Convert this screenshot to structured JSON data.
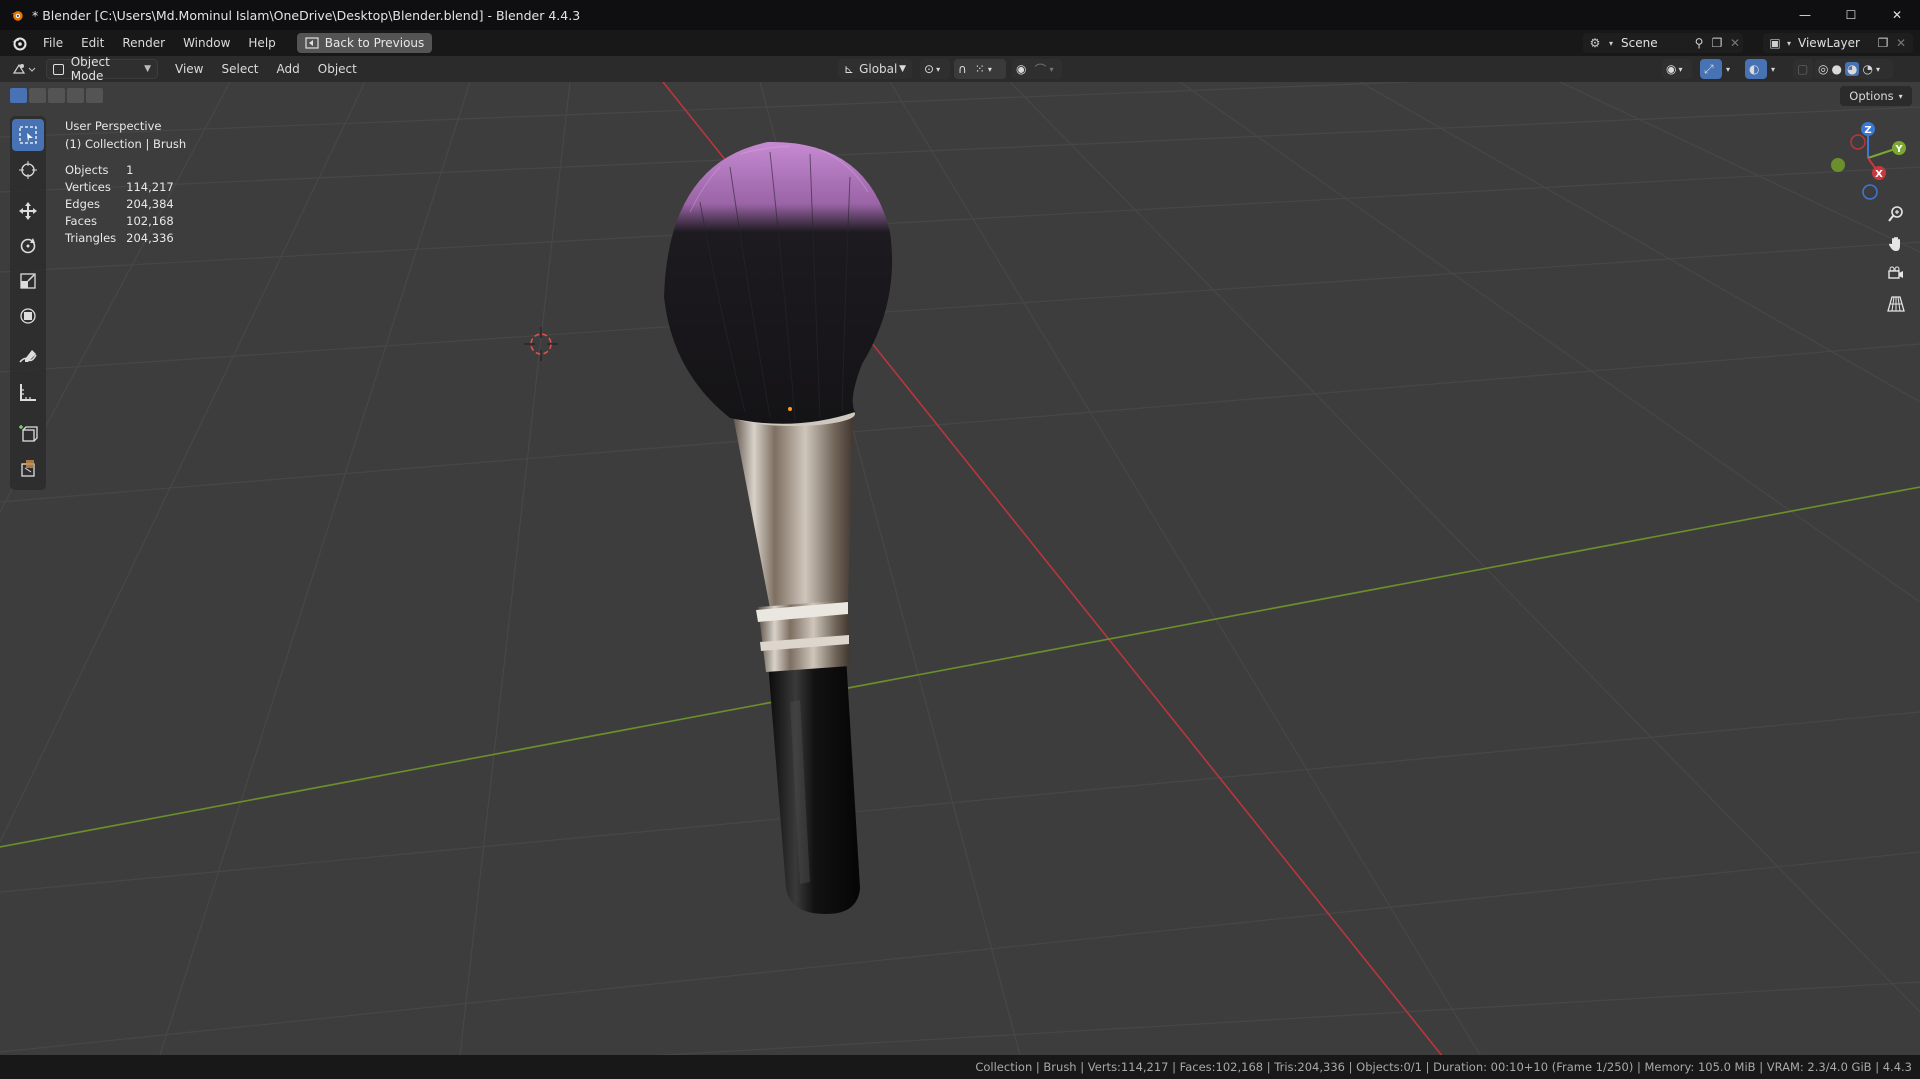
{
  "window": {
    "title": "* Blender [C:\\Users\\Md.Mominul Islam\\OneDrive\\Desktop\\Blender.blend] - Blender 4.4.3",
    "minimize": "—",
    "maximize": "☐",
    "close": "✕"
  },
  "menubar": {
    "items": [
      "File",
      "Edit",
      "Render",
      "Window",
      "Help"
    ],
    "back_button": "Back to Previous",
    "scene": "Scene",
    "view_layer": "ViewLayer"
  },
  "viewport_header": {
    "mode": "Object Mode",
    "menus": [
      "View",
      "Select",
      "Add",
      "Object"
    ],
    "transform_orientation": "Global"
  },
  "viewport": {
    "perspective": "User Perspective",
    "collection": "(1) Collection | Brush",
    "options": "Options",
    "stats": [
      {
        "label": "Objects",
        "value": "1"
      },
      {
        "label": "Vertices",
        "value": "114,217"
      },
      {
        "label": "Edges",
        "value": "204,384"
      },
      {
        "label": "Faces",
        "value": "102,168"
      },
      {
        "label": "Triangles",
        "value": "204,336"
      }
    ],
    "gizmo": {
      "x": "X",
      "y": "Y",
      "z": "Z"
    }
  },
  "statusbar": {
    "text": "Collection | Brush | Verts:114,217 | Faces:102,168 | Tris:204,336 | Objects:0/1 | Duration: 00:10+10 (Frame 1/250) | Memory: 105.0 MiB | VRAM: 2.3/4.0 GiB | 4.4.3"
  },
  "colors": {
    "accent": "#4772b3",
    "x_axis": "#c9383f",
    "y_axis": "#7ba733",
    "z_axis": "#3b78d8",
    "brush_tip": "#c68ad2"
  }
}
